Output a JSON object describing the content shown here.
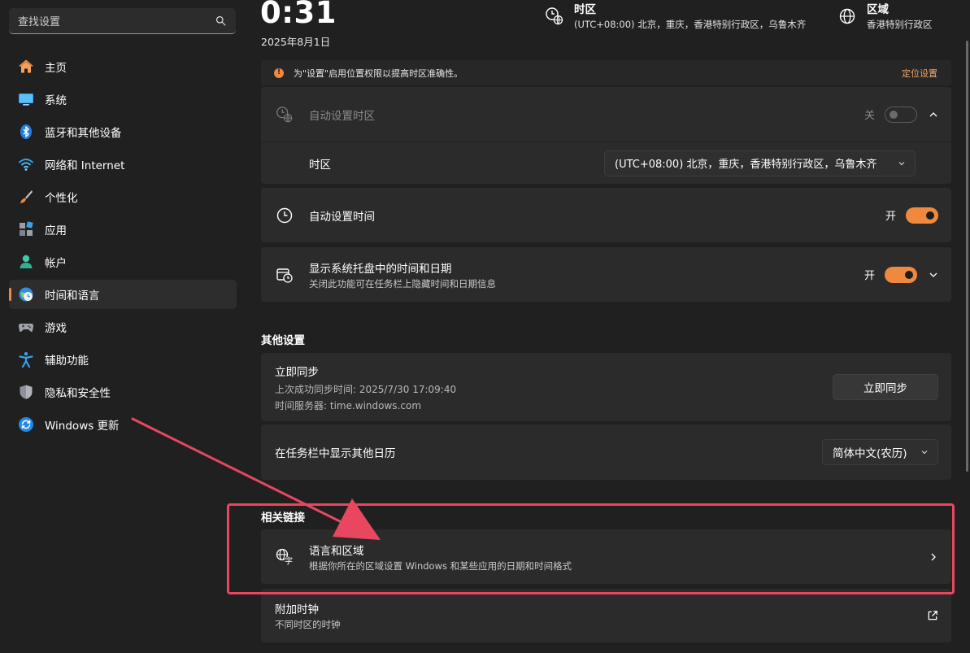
{
  "search": {
    "placeholder": "查找设置",
    "icon": "search-icon"
  },
  "sidebar": {
    "items": [
      {
        "label": "主页",
        "icon": "home-icon",
        "active": false
      },
      {
        "label": "系统",
        "icon": "monitor-icon",
        "active": false
      },
      {
        "label": "蓝牙和其他设备",
        "icon": "bluetooth-icon",
        "active": false
      },
      {
        "label": "网络和 Internet",
        "icon": "wifi-icon",
        "active": false
      },
      {
        "label": "个性化",
        "icon": "brush-icon",
        "active": false
      },
      {
        "label": "应用",
        "icon": "apps-icon",
        "active": false
      },
      {
        "label": "帐户",
        "icon": "account-icon",
        "active": false
      },
      {
        "label": "时间和语言",
        "icon": "time-language-icon",
        "active": true
      },
      {
        "label": "游戏",
        "icon": "gamepad-icon",
        "active": false
      },
      {
        "label": "辅助功能",
        "icon": "accessibility-icon",
        "active": false
      },
      {
        "label": "隐私和安全性",
        "icon": "shield-icon",
        "active": false
      },
      {
        "label": "Windows 更新",
        "icon": "update-icon",
        "active": false
      }
    ]
  },
  "header": {
    "time": "0:31",
    "date": "2025年8月1日",
    "timezone_title": "时区",
    "timezone_value": "(UTC+08:00) 北京，重庆，香港特别行政区，乌鲁木齐",
    "region_title": "区域",
    "region_value": "香港特别行政区"
  },
  "location_notice": {
    "text": "为\"设置\"启用位置权限以提高时区准确性。",
    "link": "定位设置"
  },
  "auto_timezone": {
    "label": "自动设置时区",
    "state_label": "关",
    "enabled": false
  },
  "timezone_row": {
    "label": "时区",
    "value": "(UTC+08:00) 北京，重庆，香港特别行政区，乌鲁木齐"
  },
  "auto_time": {
    "label": "自动设置时间",
    "state_label": "开",
    "enabled": true
  },
  "tray_time": {
    "label": "显示系统托盘中的时间和日期",
    "description": "关闭此功能可在任务栏上隐藏时间和日期信息",
    "state_label": "开",
    "enabled": true
  },
  "other_settings": {
    "title": "其他设置",
    "sync": {
      "label": "立即同步",
      "last_sync": "上次成功同步时间: 2025/7/30 17:09:40",
      "server": "时间服务器: time.windows.com",
      "button": "立即同步"
    },
    "calendar": {
      "label": "在任务栏中显示其他日历",
      "value": "简体中文(农历)"
    }
  },
  "related": {
    "title": "相关链接",
    "language_region": {
      "label": "语言和区域",
      "description": "根据你所在的区域设置 Windows 和某些应用的日期和时间格式"
    },
    "additional_clocks": {
      "label": "附加时钟",
      "description": "不同时区的时钟"
    }
  },
  "colors": {
    "accent": "#f0883e",
    "annotation": "#e8475f",
    "background": "#202020",
    "card": "#2b2b2b"
  }
}
